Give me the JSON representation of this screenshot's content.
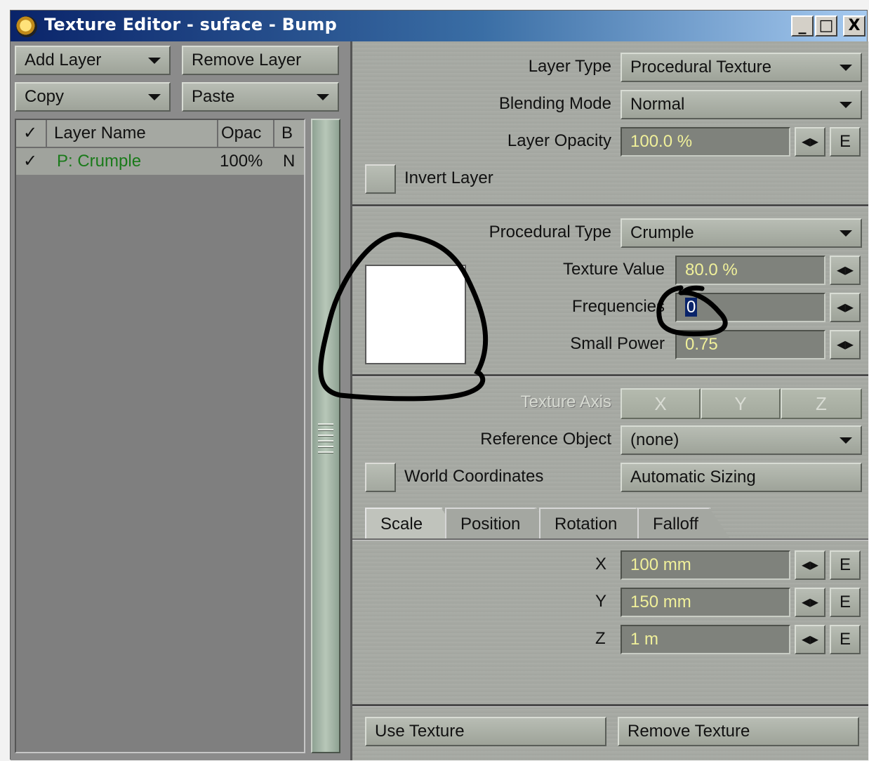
{
  "window": {
    "title": "Texture Editor - suface - Bump",
    "controls": {
      "minimize": "_",
      "maximize": "□",
      "close": "X"
    }
  },
  "left": {
    "add_layer": "Add Layer",
    "remove_layer": "Remove Layer",
    "copy": "Copy",
    "paste": "Paste",
    "list_headers": {
      "check": "✓",
      "name": "Layer Name",
      "opacity": "Opac",
      "blend": "B"
    },
    "layers": [
      {
        "check": "✓",
        "name": "P: Crumple",
        "opacity": "100%",
        "blend": "N"
      }
    ]
  },
  "layer_settings": {
    "layer_type_label": "Layer Type",
    "layer_type_value": "Procedural Texture",
    "blending_mode_label": "Blending Mode",
    "blending_mode_value": "Normal",
    "layer_opacity_label": "Layer Opacity",
    "layer_opacity_value": "100.0 %",
    "envelope_label": "E",
    "invert_layer_label": "Invert Layer"
  },
  "procedural": {
    "type_label": "Procedural Type",
    "type_value": "Crumple",
    "texture_value_label": "Texture Value",
    "texture_value": "80.0 %",
    "frequencies_label": "Frequencies",
    "frequencies_value": "0",
    "small_power_label": "Small Power",
    "small_power_value": "0.75"
  },
  "axis": {
    "label": "Texture Axis",
    "x": "X",
    "y": "Y",
    "z": "Z"
  },
  "reference": {
    "label": "Reference Object",
    "value": "(none)",
    "world_coordinates_label": "World Coordinates",
    "automatic_sizing": "Automatic Sizing"
  },
  "tabs": [
    {
      "label": "Scale"
    },
    {
      "label": "Position"
    },
    {
      "label": "Rotation"
    },
    {
      "label": "Falloff"
    }
  ],
  "scale": {
    "x_label": "X",
    "x_value": "100 mm",
    "y_label": "Y",
    "y_value": "150 mm",
    "z_label": "Z",
    "z_value": "1 m",
    "envelope_label": "E"
  },
  "footer": {
    "use_texture": "Use Texture",
    "remove_texture": "Remove Texture"
  },
  "colors": {
    "title_bar": "#0a246a",
    "panel": "#a7aaa4",
    "field_text": "#f0f09a",
    "layer_name": "#1a7a1a"
  },
  "icons": [
    "lightwave-logo-icon",
    "minimize-icon",
    "maximize-icon",
    "close-icon",
    "dropdown-arrow-icon",
    "slider-arrows-icon",
    "checkmark-icon"
  ]
}
